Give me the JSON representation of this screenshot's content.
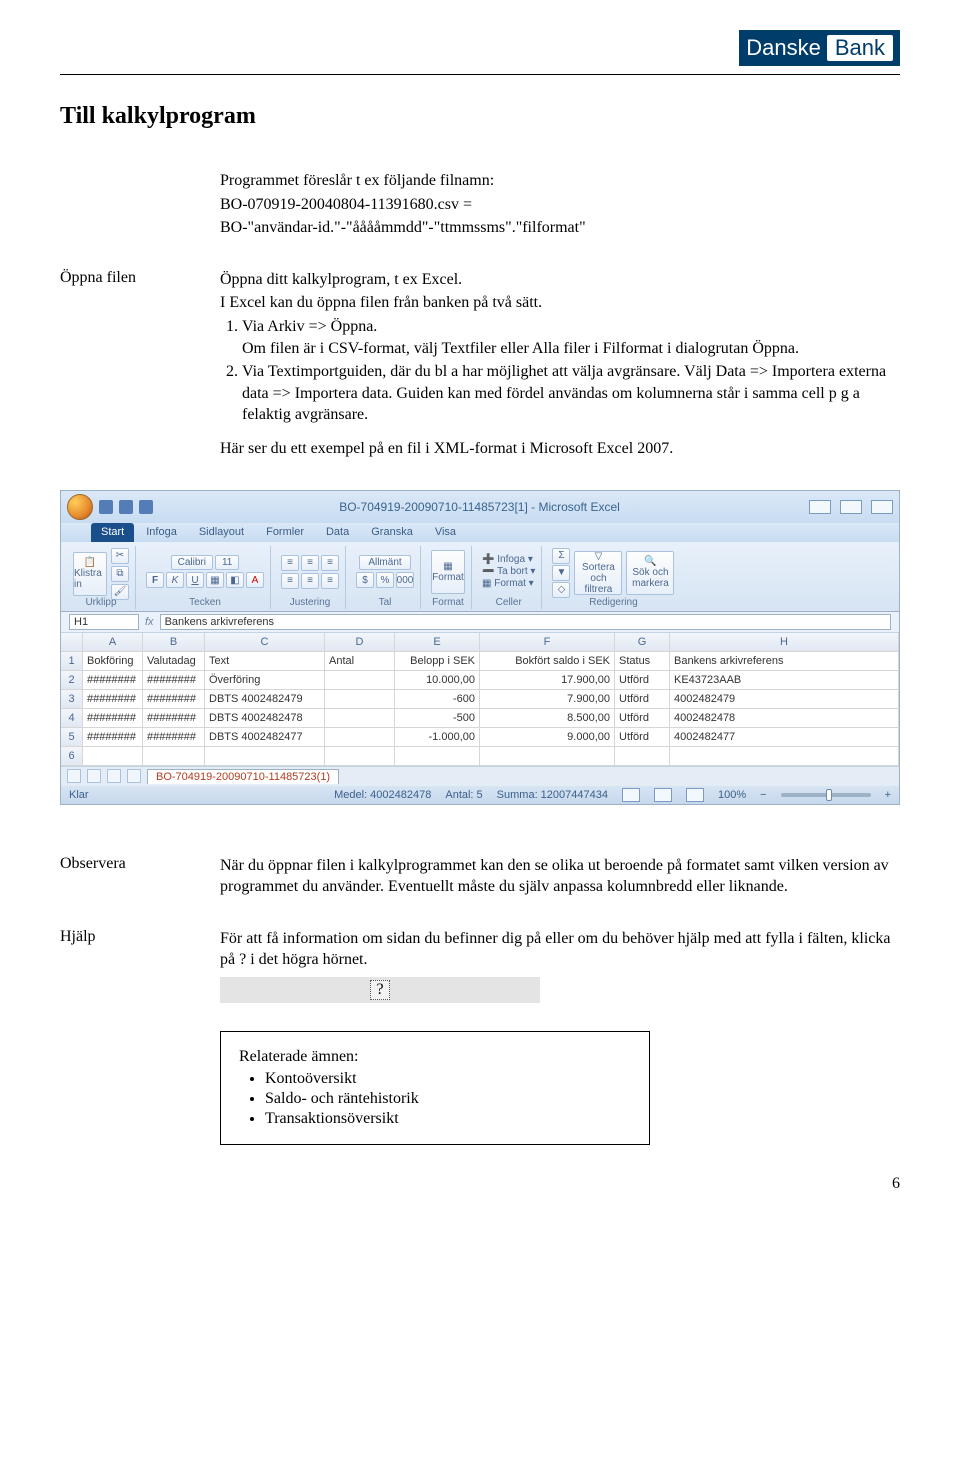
{
  "logo": {
    "part1": "Danske",
    "part2": "Bank"
  },
  "title": "Till kalkylprogram",
  "intro": {
    "p1": "Programmet föreslår t ex följande filnamn:",
    "p2": "BO-070919-20040804-11391680.csv =",
    "p3": "BO-\"användar-id.\"-\"ååååmmdd\"-\"ttmmssms\".\"filformat\""
  },
  "open": {
    "label": "Öppna filen",
    "p1": "Öppna ditt kalkylprogram, t ex Excel.",
    "p2": "I Excel kan du öppna filen från banken på två sätt.",
    "li1": "Via Arkiv => Öppna.\nOm filen är i CSV-format, välj Textfiler eller Alla filer i Filformat i dialogrutan Öppna.",
    "li2": "Via Textimportguiden, där du bl a har möjlighet att välja avgränsare. Välj Data => Importera externa data => Importera data. Guiden kan med fördel användas om kolumnerna står i samma cell p g a felaktig avgränsare.",
    "p3": "Här ser du ett exempel på en fil i XML-format i Microsoft Excel 2007."
  },
  "excel": {
    "title": "BO-704919-20090710-11485723[1] - Microsoft Excel",
    "tabs": [
      "Start",
      "Infoga",
      "Sidlayout",
      "Formler",
      "Data",
      "Granska",
      "Visa"
    ],
    "ribbon": {
      "clipboard": {
        "paste": "Klistra in",
        "label": "Urklipp"
      },
      "font": {
        "name": "Calibri",
        "size": "11",
        "label": "Tecken"
      },
      "align": {
        "label": "Justering"
      },
      "number": {
        "fmt": "Allmänt",
        "label": "Tal"
      },
      "styles": {
        "formatbtn": "Format",
        "label": "Format"
      },
      "cells": {
        "insert": "Infoga",
        "delete": "Ta bort",
        "format": "Format",
        "label": "Celler"
      },
      "editing": {
        "sort": "Sortera och filtrera",
        "find": "Sök och markera",
        "label": "Redigering"
      }
    },
    "namebox": "H1",
    "formula": "Bankens arkivreferens",
    "cols": [
      "A",
      "B",
      "C",
      "D",
      "E",
      "F",
      "G",
      "H"
    ],
    "rows": [
      {
        "n": "1",
        "A": "Bokföring",
        "B": "Valutadag",
        "C": "Text",
        "D": "Antal",
        "E": "Belopp i SEK",
        "F": "Bokfört saldo i SEK",
        "G": "Status",
        "H": "Bankens arkivreferens"
      },
      {
        "n": "2",
        "A": "########",
        "B": "########",
        "C": "Överföring",
        "D": "",
        "E": "10.000,00",
        "F": "17.900,00",
        "G": "Utförd",
        "H": "KE43723AAB"
      },
      {
        "n": "3",
        "A": "########",
        "B": "########",
        "C": "DBTS 4002482479",
        "D": "",
        "E": "-600",
        "F": "7.900,00",
        "G": "Utförd",
        "H": "4002482479"
      },
      {
        "n": "4",
        "A": "########",
        "B": "########",
        "C": "DBTS 4002482478",
        "D": "",
        "E": "-500",
        "F": "8.500,00",
        "G": "Utförd",
        "H": "4002482478"
      },
      {
        "n": "5",
        "A": "########",
        "B": "########",
        "C": "DBTS 4002482477",
        "D": "",
        "E": "-1.000,00",
        "F": "9.000,00",
        "G": "Utförd",
        "H": "4002482477"
      },
      {
        "n": "6",
        "A": "",
        "B": "",
        "C": "",
        "D": "",
        "E": "",
        "F": "",
        "G": "",
        "H": ""
      }
    ],
    "sheettab": "BO-704919-20090710-11485723(1)",
    "status": {
      "ready": "Klar",
      "avg": "Medel: 4002482478",
      "count": "Antal: 5",
      "sum": "Summa: 12007447434",
      "zoom": "100%"
    }
  },
  "observe": {
    "label": "Observera",
    "text": "När du öppnar filen i kalkylprogrammet kan den se olika ut beroende på formatet samt vilken version av programmet du använder. Eventuellt måste du själv anpassa kolumnbredd eller liknande."
  },
  "help": {
    "label": "Hjälp",
    "text": "För att få information om sidan du befinner dig på eller om du behöver hjälp med att fylla i fälten, klicka på ? i det högra hörnet.",
    "icon": "?"
  },
  "related": {
    "title": "Relaterade ämnen:",
    "items": [
      "Kontoöversikt",
      "Saldo- och räntehistorik",
      "Transaktionsöversikt"
    ]
  },
  "pagenum": "6"
}
